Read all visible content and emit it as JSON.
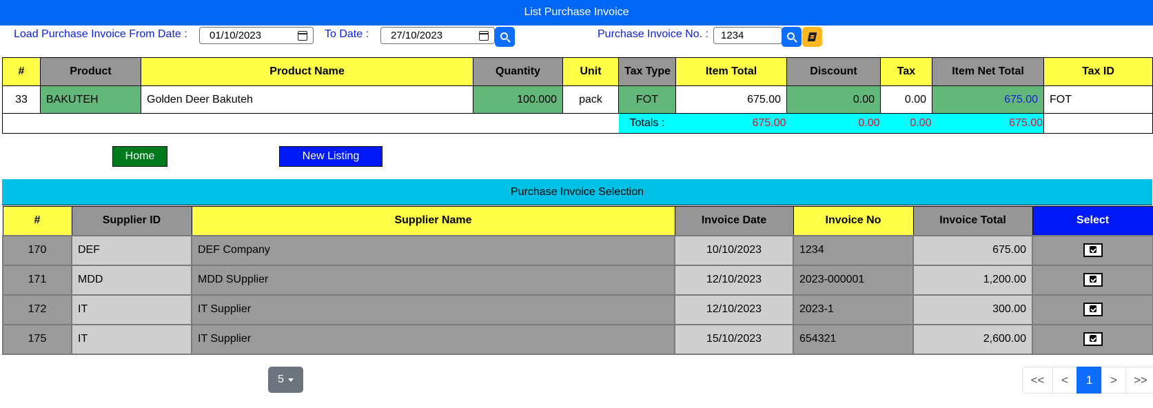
{
  "title": "List Purchase Invoice",
  "filters": {
    "from_label": "Load Purchase Invoice From Date :",
    "from_value": "01/10/2023",
    "to_label": "To Date :",
    "to_value": "27/10/2023",
    "invoice_no_label": "Purchase Invoice No. :",
    "invoice_no_value": "1234"
  },
  "items_table": {
    "headers": [
      "#",
      "Product",
      "Product Name",
      "Quantity",
      "Unit",
      "Tax Type",
      "Item Total",
      "Discount",
      "Tax",
      "Item Net Total",
      "Tax ID"
    ],
    "rows": [
      [
        "33",
        "BAKUTEH",
        "Golden Deer Bakuteh",
        "100.000",
        "pack",
        "FOT",
        "675.00",
        "0.00",
        "0.00",
        "675.00",
        "FOT"
      ]
    ],
    "totals": {
      "label": "Totals :",
      "item_total": "675.00",
      "discount": "0.00",
      "tax": "0.00",
      "net_total": "675.00"
    }
  },
  "buttons": {
    "home": "Home",
    "new_listing": "New Listing"
  },
  "selection": {
    "title": "Purchase Invoice Selection",
    "headers": [
      "#",
      "Supplier ID",
      "Supplier Name",
      "Invoice Date",
      "Invoice No",
      "Invoice Total",
      "Select"
    ],
    "rows": [
      [
        "170",
        "DEF",
        "DEF Company",
        "10/10/2023",
        "1234",
        "675.00"
      ],
      [
        "171",
        "MDD",
        "MDD SUpplier",
        "12/10/2023",
        "2023-000001",
        "1,200.00"
      ],
      [
        "172",
        "IT",
        "IT Supplier",
        "12/10/2023",
        "2023-1",
        "300.00"
      ],
      [
        "175",
        "IT",
        "IT Supplier",
        "15/10/2023",
        "654321",
        "2,600.00"
      ]
    ]
  },
  "pagination": {
    "page_size": "5",
    "pages": [
      "<<",
      "<",
      "1",
      ">",
      ">>"
    ],
    "active": "1"
  },
  "icons": {
    "search": "search-icon",
    "book": "book-icon",
    "calendar": "calendar-icon",
    "checkbox": "checked-checkbox-icon"
  },
  "colors": {
    "title_bar": "#0066f6",
    "header_yellow": "#ffff47",
    "header_gray": "#969696",
    "green": "#63b77a",
    "cyan": "#00ffff",
    "select_blue": "#0019f7"
  }
}
